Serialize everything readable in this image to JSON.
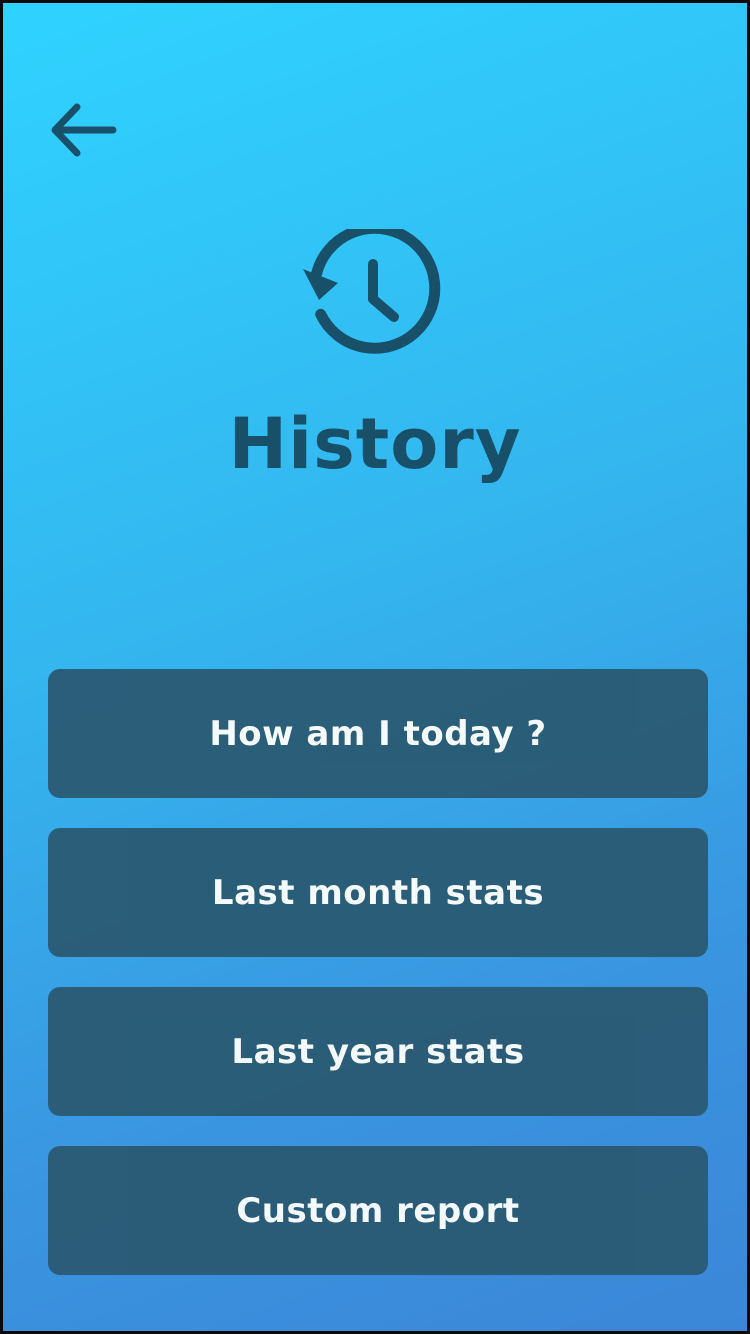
{
  "header": {
    "back_icon": "arrow-left-icon",
    "history_icon": "history-clock-icon",
    "title": "History"
  },
  "menu": {
    "items": [
      {
        "label": "How am I today ?"
      },
      {
        "label": "Last month stats"
      },
      {
        "label": "Last year stats"
      },
      {
        "label": "Custom report"
      }
    ]
  },
  "colors": {
    "background_top": "#2fd3ff",
    "background_bottom": "#3b86d8",
    "accent_dark": "#18506a",
    "button_bg": "#2a5a73",
    "button_text": "#ffffff"
  }
}
